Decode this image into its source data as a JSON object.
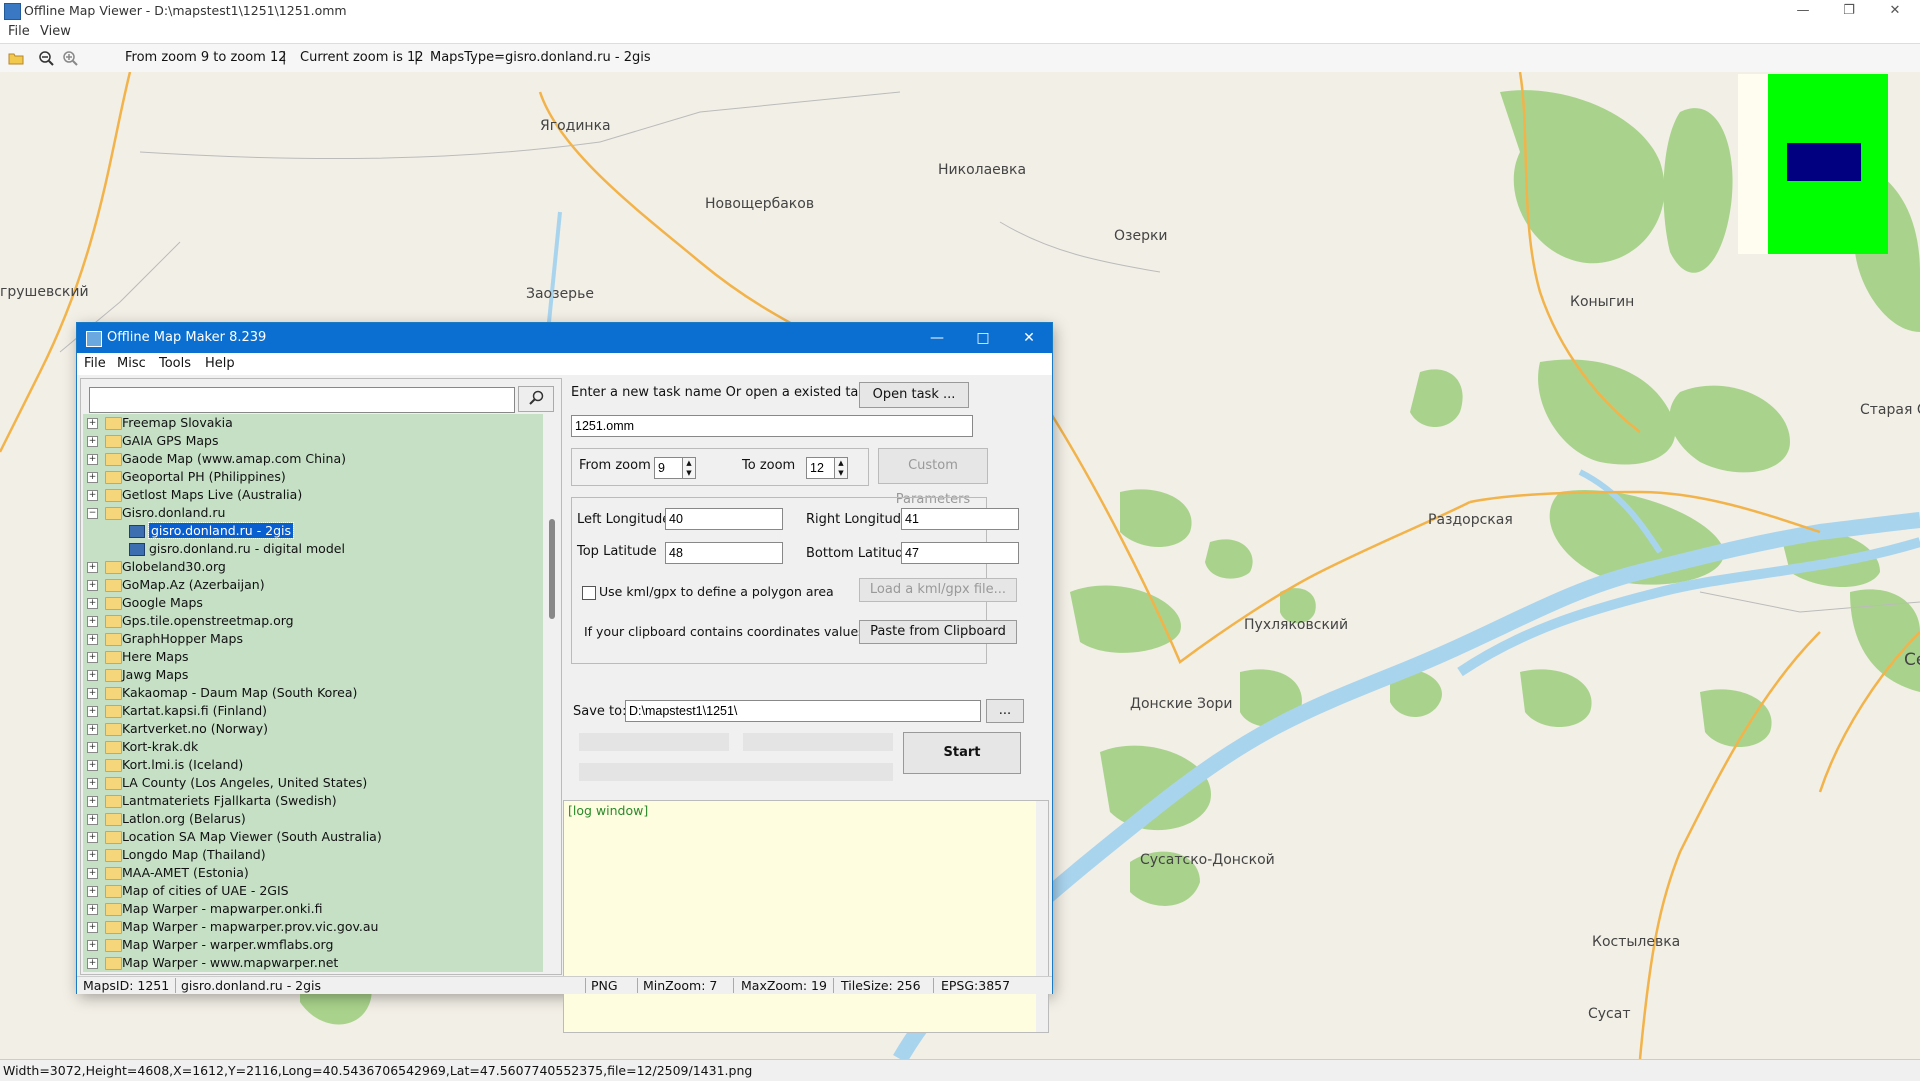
{
  "outer": {
    "title": "Offline Map Viewer - D:\\mapstest1\\1251\\1251.omm",
    "menu": [
      "File",
      "View"
    ],
    "toolbar_zoom_range": "From zoom 9 to zoom 12",
    "toolbar_current_zoom": "Current zoom is 12",
    "toolbar_maps_type": "MapsType=gisro.donland.ru - 2gis",
    "toolbar_sep": "|",
    "status": "Width=3072,Height=4608,X=1612,Y=2116,Long=40.5436706542969,Lat=47.5607740552375,file=12/2509/1431.png"
  },
  "map": {
    "places": [
      "Ягодинка",
      "Николаевка",
      "Новощербаков",
      "Озерки",
      "грушевский",
      "Заозерье",
      "Коныгин",
      "Старая С",
      "Раздорская",
      "Пухляковский",
      "Донские Зори",
      "Сусатско-Донской",
      "Костылевка",
      "Сусат",
      "Се"
    ],
    "colors": {
      "land": "#f2efe6",
      "forest": "#a9d38c",
      "water": "#a9d4ee",
      "road": "#f2b34a"
    }
  },
  "minimap": {
    "colors": {
      "bg": "#fffdf0",
      "area": "#00ff00",
      "view": "#000080"
    }
  },
  "dialog": {
    "title": "Offline Map Maker 8.239",
    "menu": [
      "File",
      "Misc",
      "Tools",
      "Help"
    ],
    "search_value": "",
    "tree": [
      {
        "label": "Freemap Slovakia",
        "type": "folder"
      },
      {
        "label": "GAIA GPS Maps",
        "type": "folder"
      },
      {
        "label": "Gaode Map (www.amap.com China)",
        "type": "folder"
      },
      {
        "label": "Geoportal PH (Philippines)",
        "type": "folder"
      },
      {
        "label": "Getlost Maps Live (Australia)",
        "type": "folder"
      },
      {
        "label": "Gisro.donland.ru",
        "type": "folder",
        "expanded": true
      },
      {
        "label": "gisro.donland.ru - 2gis",
        "type": "map",
        "selected": true
      },
      {
        "label": "gisro.donland.ru - digital model",
        "type": "map"
      },
      {
        "label": "Globeland30.org",
        "type": "folder"
      },
      {
        "label": "GoMap.Az (Azerbaijan)",
        "type": "folder"
      },
      {
        "label": "Google Maps",
        "type": "folder"
      },
      {
        "label": "Gps.tile.openstreetmap.org",
        "type": "folder"
      },
      {
        "label": "GraphHopper Maps",
        "type": "folder"
      },
      {
        "label": "Here Maps",
        "type": "folder"
      },
      {
        "label": "Jawg Maps",
        "type": "folder"
      },
      {
        "label": "Kakaomap - Daum Map (South Korea)",
        "type": "folder"
      },
      {
        "label": "Kartat.kapsi.fi (Finland)",
        "type": "folder"
      },
      {
        "label": "Kartverket.no (Norway)",
        "type": "folder"
      },
      {
        "label": "Kort-krak.dk",
        "type": "folder"
      },
      {
        "label": "Kort.lmi.is (Iceland)",
        "type": "folder"
      },
      {
        "label": "LA County (Los Angeles, United States)",
        "type": "folder"
      },
      {
        "label": "Lantmateriets Fjallkarta (Swedish)",
        "type": "folder"
      },
      {
        "label": "Latlon.org (Belarus)",
        "type": "folder"
      },
      {
        "label": "Location SA Map Viewer (South Australia)",
        "type": "folder"
      },
      {
        "label": "Longdo Map (Thailand)",
        "type": "folder"
      },
      {
        "label": "MAA-AMET (Estonia)",
        "type": "folder"
      },
      {
        "label": "Map of cities of UAE - 2GIS",
        "type": "folder"
      },
      {
        "label": "Map Warper - mapwarper.onki.fi",
        "type": "folder"
      },
      {
        "label": "Map Warper - mapwarper.prov.vic.gov.au",
        "type": "folder"
      },
      {
        "label": "Map Warper - warper.wmflabs.org",
        "type": "folder"
      },
      {
        "label": "Map Warper - www.mapwarper.net",
        "type": "folder"
      }
    ],
    "task_prompt": "Enter a new task name Or open a existed task to continue:",
    "open_task": "Open task ...",
    "task_name": "1251.omm",
    "from_zoom_label": "From zoom",
    "from_zoom": "9",
    "to_zoom_label": "To zoom",
    "to_zoom": "12",
    "custom_params": "Custom Parameters",
    "left_lon_label": "Left Longitude",
    "left_lon": "40",
    "right_lon_label": "Right Longitude",
    "right_lon": "41",
    "top_lat_label": "Top Latitude",
    "top_lat": "48",
    "bottom_lat_label": "Bottom Latitude",
    "bottom_lat": "47",
    "kml_check": "Use kml/gpx to define a polygon area",
    "kml_checked": false,
    "load_kml": "Load a kml/gpx file...",
    "clipboard_text": "If your clipboard contains coordinates values:",
    "paste_btn": "Paste from Clipboard",
    "save_to_label": "Save to:",
    "save_to": "D:\\mapstest1\\1251\\",
    "browse": "...",
    "start": "Start",
    "log": "[log window]",
    "status": {
      "maps_id": "MapsID: 1251",
      "map_name": "gisro.donland.ru - 2gis",
      "format": "PNG",
      "min_zoom": "MinZoom: 7",
      "max_zoom": "MaxZoom: 19",
      "tile_size": "TileSize: 256",
      "epsg": "EPSG:3857"
    }
  }
}
